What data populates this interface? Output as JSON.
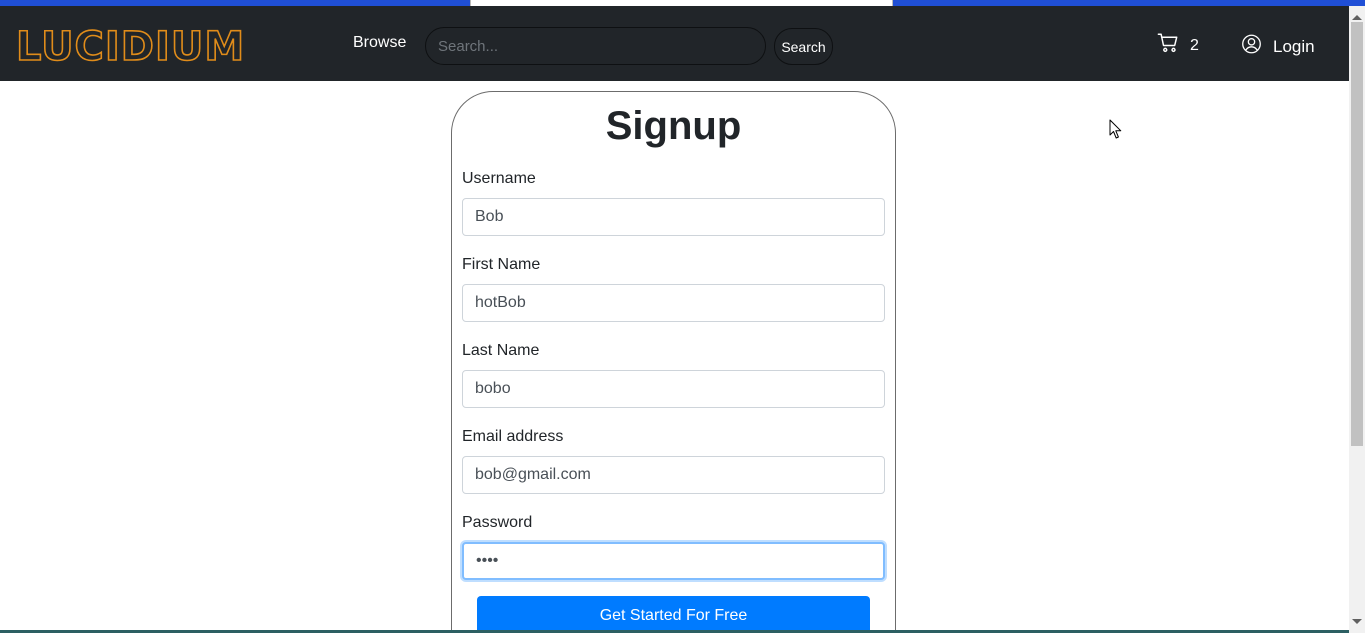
{
  "brand": {
    "name": "LUCIDIUM",
    "color": "#e08c1a"
  },
  "navbar": {
    "browse_label": "Browse",
    "search_placeholder": "Search...",
    "search_button": "Search",
    "cart_count": "2",
    "login_label": "Login",
    "background": "#212529"
  },
  "form": {
    "title": "Signup",
    "fields": [
      {
        "label": "Username",
        "value": "Bob"
      },
      {
        "label": "First Name",
        "value": "hotBob"
      },
      {
        "label": "Last Name",
        "value": "bobo"
      },
      {
        "label": "Email address",
        "value": "bob@gmail.com"
      },
      {
        "label": "Password",
        "value": "boba"
      }
    ],
    "submit_label": "Get Started For Free",
    "submit_color": "#007bff"
  },
  "icons": [
    "cart-icon",
    "user-circle-icon",
    "mouse-pointer-icon"
  ]
}
